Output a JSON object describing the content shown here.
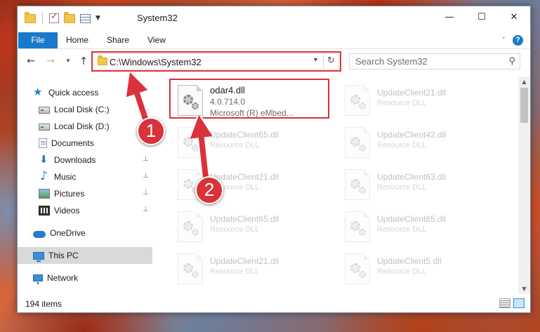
{
  "window": {
    "title": "System32",
    "controls": {
      "minimize": "—",
      "maximize": "☐",
      "close": "✕"
    }
  },
  "ribbon": {
    "tabs": [
      "File",
      "Home",
      "Share",
      "View"
    ],
    "collapse_icon": "chevron-up-icon",
    "help": "?"
  },
  "nav": {
    "back": "←",
    "forward": "→",
    "recent": "▾",
    "up": "↑",
    "address": "C:\\Windows\\System32",
    "address_dropdown": "▾",
    "refresh": "↻",
    "search_placeholder": "Search System32",
    "search_icon": "⚲"
  },
  "sidebar": {
    "items": [
      {
        "label": "Quick access",
        "icon": "star-icon"
      },
      {
        "label": "Local Disk (C:)",
        "icon": "disk-icon",
        "pinned": true
      },
      {
        "label": "Local Disk (D:)",
        "icon": "disk-icon"
      },
      {
        "label": "Documents",
        "icon": "documents-icon",
        "pinned": true
      },
      {
        "label": "Downloads",
        "icon": "downloads-icon",
        "pinned": true
      },
      {
        "label": "Music",
        "icon": "music-icon",
        "pinned": true
      },
      {
        "label": "Pictures",
        "icon": "pictures-icon",
        "pinned": true
      },
      {
        "label": "Videos",
        "icon": "videos-icon",
        "pinned": true
      },
      {
        "label": "OneDrive",
        "icon": "onedrive-icon"
      },
      {
        "label": "This PC",
        "icon": "this-pc-icon",
        "selected": true
      },
      {
        "label": "Network",
        "icon": "network-icon"
      }
    ],
    "pin_glyph": "📌"
  },
  "files": {
    "highlighted": {
      "name": "odar4.dll",
      "version": "4.0.714.0",
      "description": "Microsoft (R) eMbed..."
    },
    "faded": [
      {
        "name": "UpdateClient21.dll",
        "type": "Resource DLL"
      },
      {
        "name": "UpdateClient65.dll",
        "type": "Resource DLL"
      },
      {
        "name": "UpdateClient42.dll",
        "type": "Resource DLL"
      },
      {
        "name": "UpdateClient21.dll",
        "type": "Resource DLL"
      },
      {
        "name": "UpdateClient63.dll",
        "type": "Resource DLL"
      },
      {
        "name": "UpdateClient65.dll",
        "type": "Resource DLL"
      },
      {
        "name": "UpdateClient65.dll",
        "type": "Resource DLL"
      },
      {
        "name": "UpdateClient21.dll",
        "type": "Resource DLL"
      },
      {
        "name": "UpdateClient5.dll",
        "type": "Resource DLL"
      }
    ]
  },
  "status": {
    "item_count": "194 items"
  },
  "annotations": {
    "step1": "1",
    "step2": "2",
    "color": "#d9323a"
  },
  "colors": {
    "accent": "#1979ca",
    "highlight": "#d9323a",
    "selection": "#d9d9d9"
  }
}
